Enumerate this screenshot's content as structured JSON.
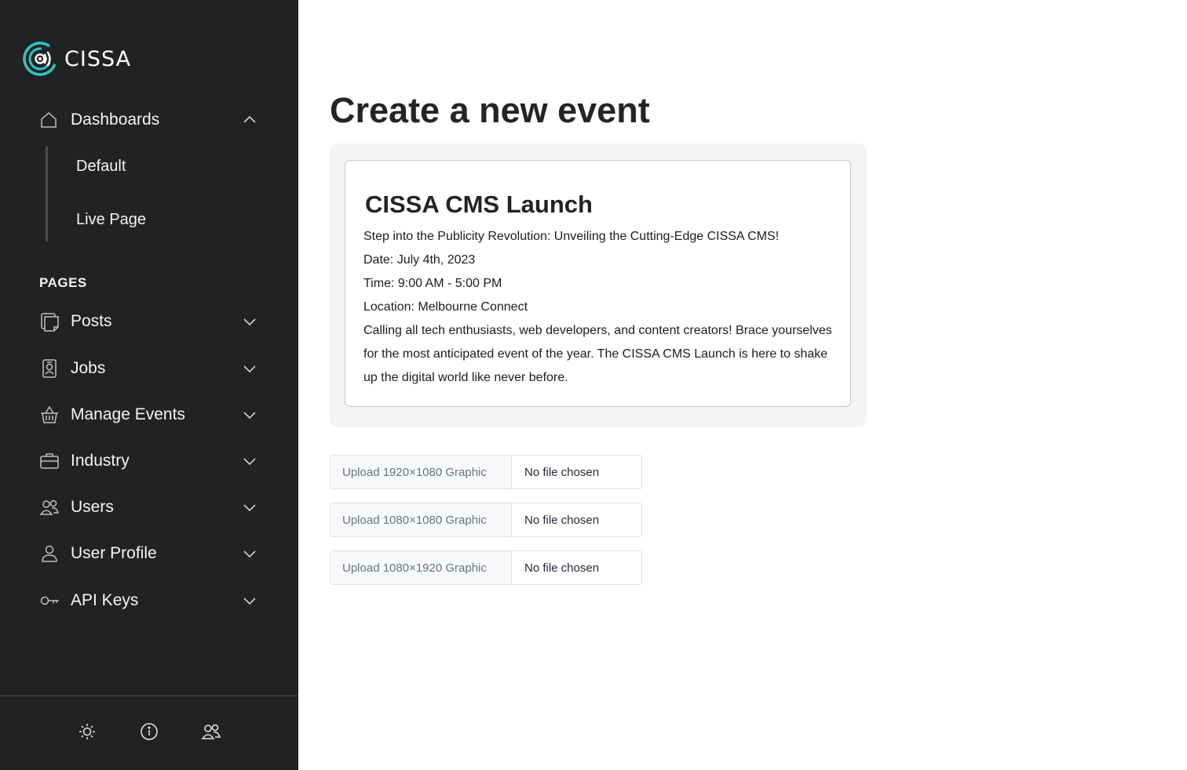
{
  "brand": {
    "name": "CISSA",
    "accent": "#2ec4c4"
  },
  "sidebar": {
    "dashboards": {
      "label": "Dashboards",
      "icon": "home-icon",
      "expanded": true,
      "children": [
        {
          "label": "Default"
        },
        {
          "label": "Live Page"
        }
      ]
    },
    "section_label": "PAGES",
    "items": [
      {
        "label": "Posts",
        "icon": "posts-icon"
      },
      {
        "label": "Jobs",
        "icon": "badge-icon"
      },
      {
        "label": "Manage Events",
        "icon": "basket-icon"
      },
      {
        "label": "Industry",
        "icon": "briefcase-icon"
      },
      {
        "label": "Users",
        "icon": "users-icon"
      },
      {
        "label": "User Profile",
        "icon": "user-icon"
      },
      {
        "label": "API Keys",
        "icon": "key-icon"
      }
    ],
    "footer_icons": [
      "sun-icon",
      "info-icon",
      "users-icon"
    ]
  },
  "main": {
    "title": "Create a new event",
    "preview": {
      "title": "CISSA CMS Launch",
      "lines": [
        "Step into the Publicity Revolution: Unveiling the Cutting-Edge CISSA CMS!",
        "Date: July 4th, 2023",
        "Time: 9:00 AM - 5:00 PM",
        "Location: Melbourne Connect",
        "Calling all tech enthusiasts, web developers, and content creators! Brace yourselves for the most anticipated event of the year. The CISSA CMS Launch is here to shake up the digital world like never before."
      ]
    },
    "uploads": [
      {
        "label": "Upload 1920×1080 Graphic",
        "value": "No file chosen"
      },
      {
        "label": "Upload 1080×1080 Graphic",
        "value": "No file chosen"
      },
      {
        "label": "Upload 1080×1920 Graphic",
        "value": "No file chosen"
      }
    ]
  }
}
